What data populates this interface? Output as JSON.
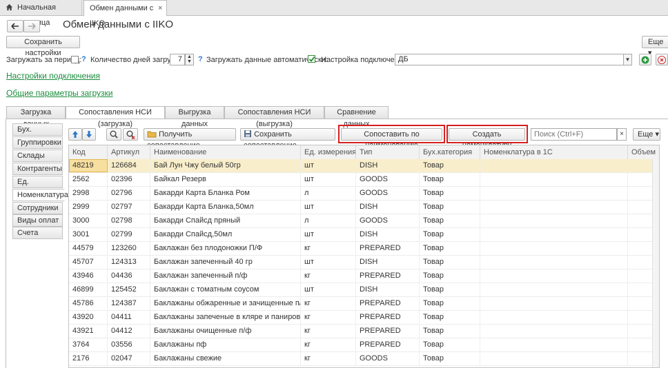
{
  "tabs": {
    "home": "Начальная страница",
    "active": "Обмен данными с IIKO",
    "close": "×"
  },
  "header": {
    "title": "Обмен данными с IIKO",
    "more_btn": "Еще",
    "save_settings": "Сохранить настройки"
  },
  "params": {
    "period_label": "Загружать за период:",
    "days_label": "Количество дней загрузки:",
    "days_value": "7",
    "auto_label": "Загружать данные автоматически:",
    "conn_label": "Настройка подключения:",
    "conn_value": "ДБ",
    "help": "?"
  },
  "links": {
    "conn_settings": "Настройки подключения",
    "general_params": "Общие параметры загрузки"
  },
  "section_tabs": [
    "Загрузка данных",
    "Сопоставления НСИ (загрузка)",
    "Выгрузка данных",
    "Сопоставления НСИ (выгрузка)",
    "Сравнение данных"
  ],
  "side_tabs": [
    "Бух. категории",
    "Группировки",
    "Склады",
    "Контрагенты",
    "Ед. измерения",
    "Номенклатура",
    "Сотрудники",
    "Виды оплат",
    "Счета"
  ],
  "toolbar": {
    "get_mapping": "Получить сопоставление",
    "save_mapping": "Сохранить сопоставление",
    "match_by_name": "Сопоставить по наименованию",
    "create_item": "Создать номенклатуру",
    "search_placeholder": "Поиск (Ctrl+F)",
    "more": "Еще"
  },
  "table": {
    "columns": [
      "Код",
      "Артикул",
      "Наименование",
      "Ед. измерения",
      "Тип",
      "Бух.категория",
      "Номенклатура в 1С",
      "Объем"
    ],
    "rows": [
      [
        "48219",
        "126684",
        "Бай Лун Чжу белый 50гр",
        "шт",
        "DISH",
        "Товар",
        "",
        ""
      ],
      [
        "2562",
        "02396",
        "Байкал Резерв",
        "шт",
        "GOODS",
        "Товар",
        "",
        ""
      ],
      [
        "2998",
        "02796",
        "Бакарди Карта Бланка Ром",
        "л",
        "GOODS",
        "Товар",
        "",
        ""
      ],
      [
        "2999",
        "02797",
        "Бакарди Карта Бланка,50мл",
        "шт",
        "DISH",
        "Товар",
        "",
        ""
      ],
      [
        "3000",
        "02798",
        "Бакарди Спайсд пряный",
        "л",
        "GOODS",
        "Товар",
        "",
        ""
      ],
      [
        "3001",
        "02799",
        "Бакарди Спайсд,50мл",
        "шт",
        "DISH",
        "Товар",
        "",
        ""
      ],
      [
        "44579",
        "123260",
        "Баклажан без плодоножки П/Ф",
        "кг",
        "PREPARED",
        "Товар",
        "",
        ""
      ],
      [
        "45707",
        "124313",
        "Баклажан запеченный 40 гр",
        "шт",
        "DISH",
        "Товар",
        "",
        ""
      ],
      [
        "43946",
        "04436",
        "Баклажан запеченный п/ф",
        "кг",
        "PREPARED",
        "Товар",
        "",
        ""
      ],
      [
        "46899",
        "125452",
        "Баклажан с томатным соусом",
        "шт",
        "DISH",
        "Товар",
        "",
        ""
      ],
      [
        "45786",
        "124387",
        "Баклажаны  обжаренные и  зачищенные п/ф",
        "кг",
        "PREPARED",
        "Товар",
        "",
        ""
      ],
      [
        "43920",
        "04411",
        "Баклажаны запеченые в кляре и панировке п/ф",
        "кг",
        "PREPARED",
        "Товар",
        "",
        ""
      ],
      [
        "43921",
        "04412",
        "Баклажаны очищенные п/ф",
        "кг",
        "PREPARED",
        "Товар",
        "",
        ""
      ],
      [
        "3764",
        "03556",
        "Баклажаны пф",
        "кг",
        "PREPARED",
        "Товар",
        "",
        ""
      ],
      [
        "2176",
        "02047",
        "Баклажаны свежие",
        "кг",
        "GOODS",
        "Товар",
        "",
        ""
      ]
    ]
  }
}
